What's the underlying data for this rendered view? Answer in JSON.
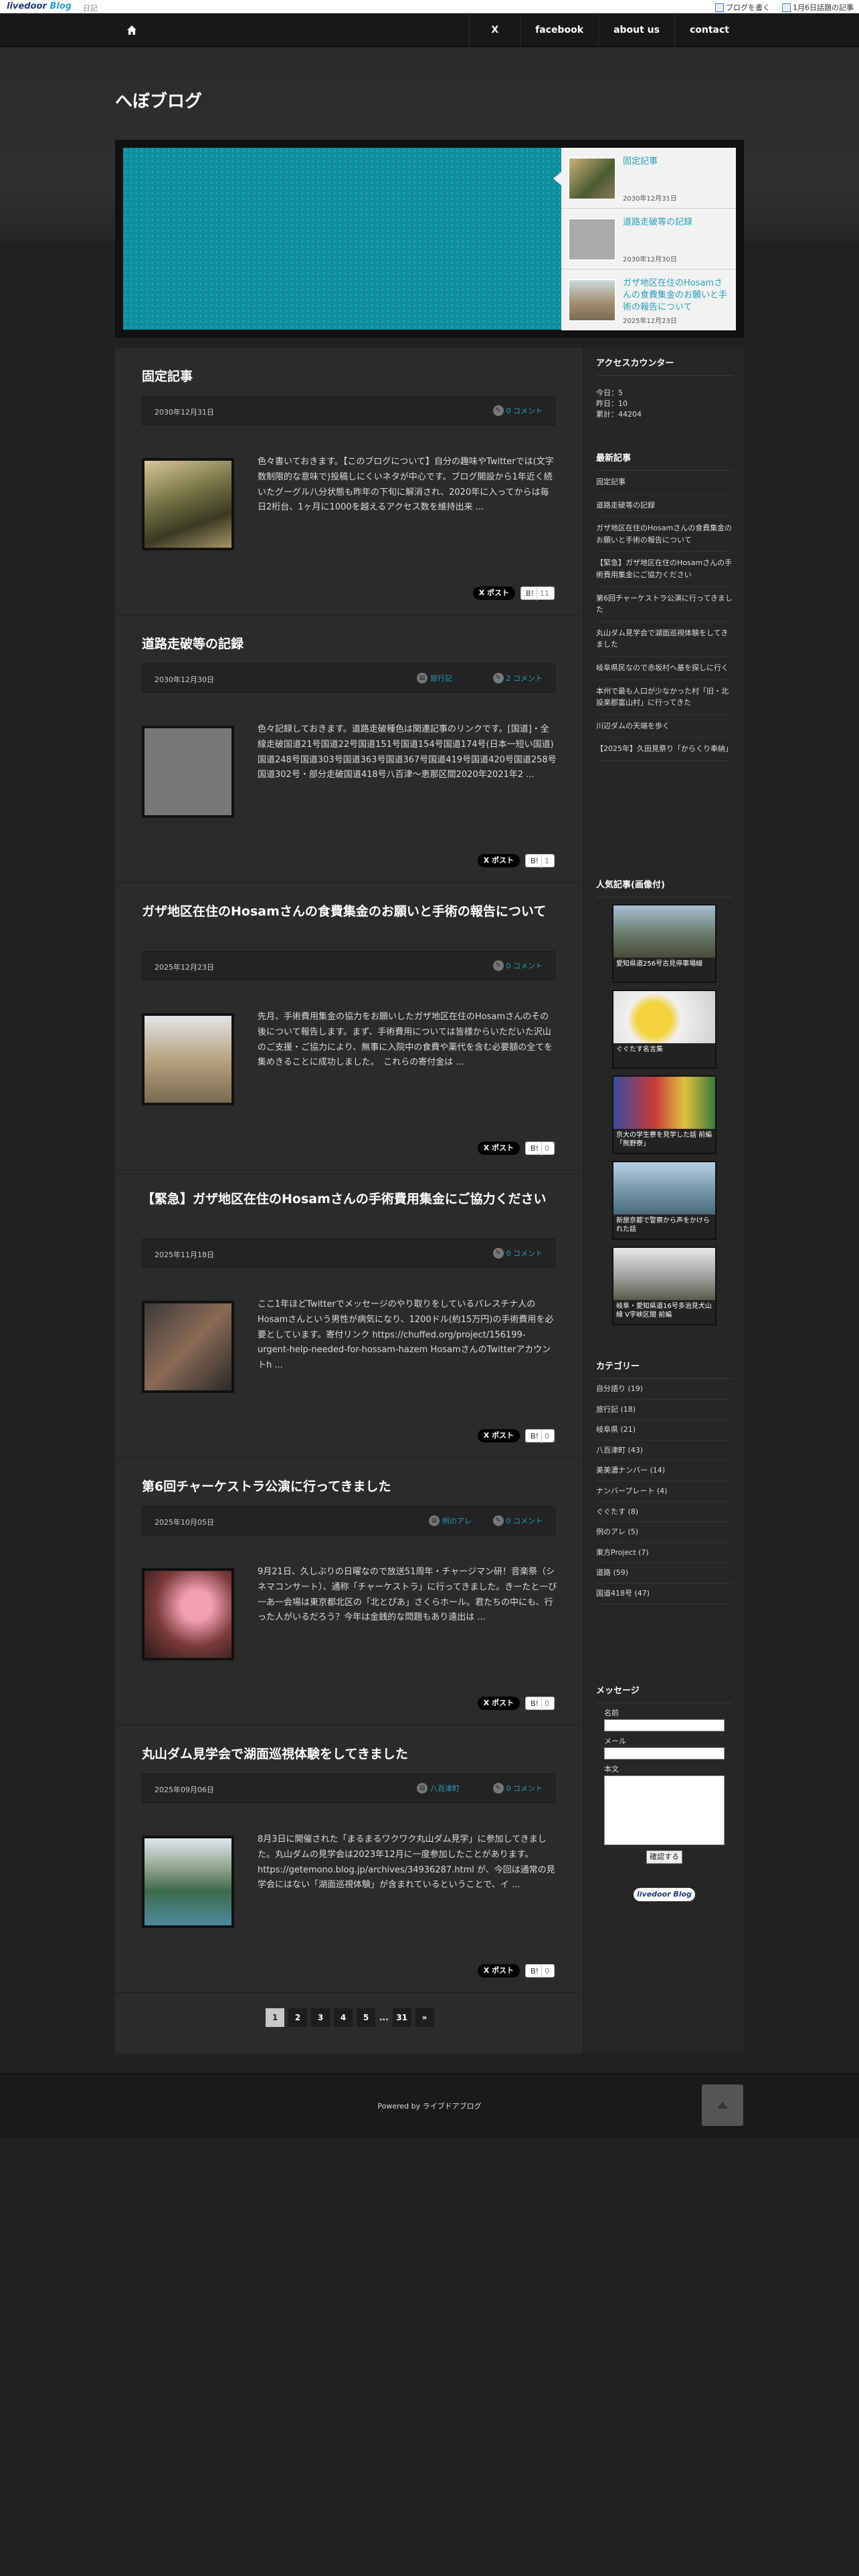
{
  "ldbar": {
    "logo_main": "livedoor",
    "logo_blog": "Blog",
    "nikki": "日記",
    "write": "ブログを書く",
    "topic": "1月6日話題の記事"
  },
  "nav": {
    "home_icon": "home-icon",
    "links": [
      "X",
      "facebook",
      "about us",
      "contact"
    ]
  },
  "blog_title": "へぼブログ",
  "slider": [
    {
      "title": "固定記事",
      "date": "2030年12月31日"
    },
    {
      "title": "道路走破等の記録",
      "date": "2030年12月30日"
    },
    {
      "title": "ガザ地区在住のHosamさんの食費集金のお願いと手術の報告について",
      "date": "2025年12月23日"
    }
  ],
  "articles": [
    {
      "title": "固定記事",
      "date": "2030年12月31日",
      "category": "",
      "comments": "0 コメント",
      "excerpt": "色々書いておきます。【このブログについて】自分の趣味やTwitterでは(文字数制限的な意味で)投稿しにくいネタが中心です。ブログ開設から1年近く続いたグーグル八分状態も昨年の下旬に解消され、2020年に入ってからは毎日2桁台、1ヶ月に1000を越えるアクセス数を維持出来 ...",
      "x": "X ポスト",
      "hatena": "B!",
      "hatena_label": "B!",
      "hatena_count": "11"
    },
    {
      "title": "道路走破等の記録",
      "date": "2030年12月30日",
      "category": "旅行記",
      "comments": "2 コメント",
      "excerpt": "色々記録しておきます。道路走破種色は関連記事のリンクです。[国道]・全線走破国道21号国道22号国道151号国道154号国道174号(日本一短い国道)国道248号国道303号国道363号国道367号国道419号国道420号国道258号国道302号・部分走破国道418号八百津～恵那区間2020年2021年2 ...",
      "x": "X ポスト",
      "hatena_label": "B!",
      "hatena_count": "1"
    },
    {
      "title": "ガザ地区在住のHosamさんの食費集金のお願いと手術の報告について",
      "date": "2025年12月23日",
      "category": "",
      "comments": "0 コメント",
      "excerpt": "先月、手術費用集金の協力をお願いしたガザ地区在住のHosamさんのその後について報告します。まず、手術費用については皆様からいただいた沢山のご支援・ご協力により、無事に入院中の食費や薬代を含む必要額の全てを集めきることに成功しました。　これらの寄付金は ...",
      "x": "X ポスト",
      "hatena_label": "B!",
      "hatena_count": "0"
    },
    {
      "title": "【緊急】ガザ地区在住のHosamさんの手術費用集金にご協力ください",
      "date": "2025年11月18日",
      "category": "",
      "comments": "0 コメント",
      "excerpt": "ここ1年ほどTwitterでメッセージのやり取りをしているパレスチナ人のHosamさんという男性が病気になり、1200ドル(約15万円)の手術費用を必要としています。寄付リンク https://chuffed.org/project/156199-urgent-help-needed-for-hossam-hazem HosamさんのTwitterアカウントh ...",
      "x": "X ポスト",
      "hatena_label": "B!",
      "hatena_count": "0"
    },
    {
      "title": "第6回チャーケストラ公演に行ってきました",
      "date": "2025年10月05日",
      "category": "例のアレ",
      "comments": "0 コメント",
      "excerpt": "9月21日、久しぶりの日曜なので放送51周年・チャージマン研！音楽祭（シネマコンサート）、通称「チャーケストラ」に行ってきました。きーたと一び一あ一会場は東京都北区の「北とぴあ」さくらホール。君たちの中にも、行った人がいるだろう？今年は金銭的な問題もあり遠出は ...",
      "x": "X ポスト",
      "hatena_label": "B!",
      "hatena_count": "0"
    },
    {
      "title": "丸山ダム見学会で湖面巡視体験をしてきました",
      "date": "2025年09月06日",
      "category": "八百津町",
      "comments": "0 コメント",
      "excerpt": "8月3日に開催された「まるまるワクワク丸山ダム見学」に参加してきました。丸山ダムの見学会は2023年12月に一度参加したことがあります。https://getemono.blog.jp/archives/34936287.html が、今回は通常の見学会にはない「湖面巡視体験」が含まれているということで、イ ...",
      "x": "X ポスト",
      "hatena_label": "B!",
      "hatena_count": "0"
    }
  ],
  "pager": [
    "1",
    "2",
    "3",
    "4",
    "5",
    "...",
    "31",
    "»"
  ],
  "sidebar": {
    "counter_title": "アクセスカウンター",
    "counter": [
      "今日：5",
      "昨日：10",
      "累計：44204"
    ],
    "recent_title": "最新記事",
    "recent": [
      "固定記事",
      "道路走破等の記録",
      "ガザ地区在住のHosamさんの食費集金のお願いと手術の報告について",
      "【緊急】ガザ地区在住のHosamさんの手術費用集金にご協力ください",
      "第6回チャーケストラ公演に行ってきました",
      "丸山ダム見学会で湖面巡視体験をしてきました",
      "岐阜県民なので赤坂村へ基を探しに行く",
      "本州で最も人口が少なかった村「旧・北設楽郡富山村」に行ってきた",
      "川辺ダムの天端を歩く",
      "【2025年】久田見祭り「からくり奉納」"
    ],
    "popular_title": "人気記事(画像付)",
    "popular": [
      "愛知県道256号古見停車場線",
      "ぐぐたす名言集",
      "京大の学生寮を見学した話 前編「熊野寮」",
      "新旅京都で警察から声をかけられた話",
      "岐阜・愛知県道16号多治見犬山線 V字峡区間 前編"
    ],
    "category_title": "カテゴリー",
    "categories": [
      "自分語り (19)",
      "旅行記 (18)",
      "岐阜県 (21)",
      "八百津町 (43)",
      "美美濃ナンバー (14)",
      "ナンバープレート (4)",
      "ぐぐたす (8)",
      "例のアレ (5)",
      "東方Project (7)",
      "道路 (59)",
      "国道418号 (47)"
    ],
    "message_title": "メッセージ",
    "form": {
      "name": "名前",
      "mail": "メール",
      "body": "本文",
      "submit": "確認する"
    },
    "ld_badge": "livedoor Blog"
  },
  "footer": {
    "powered": "Powered by ライブドアブログ",
    "top_icon": "scroll-top-icon"
  }
}
